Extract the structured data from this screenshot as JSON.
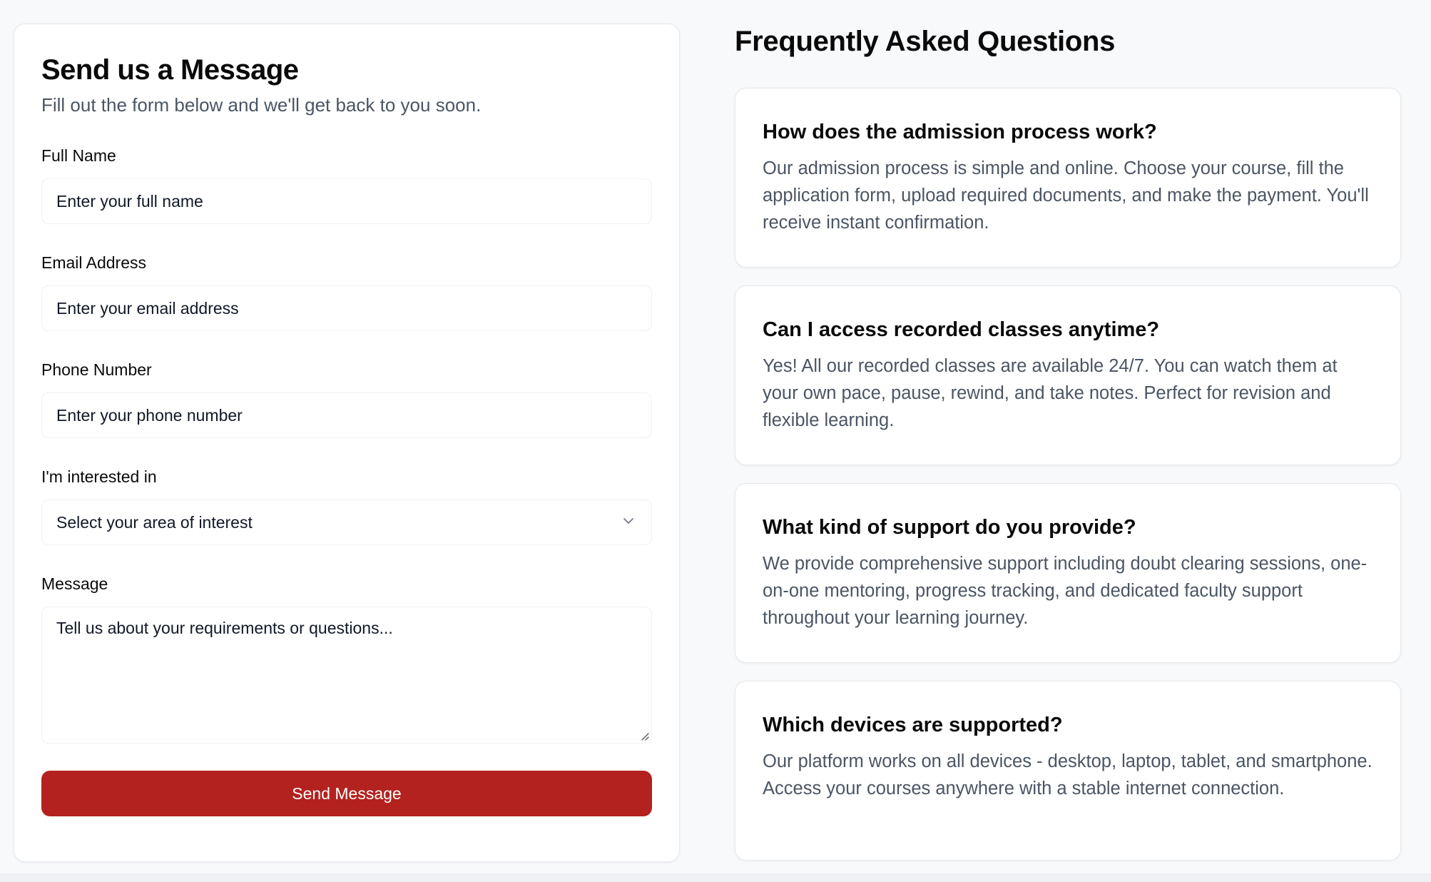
{
  "form": {
    "title": "Send us a Message",
    "subtitle": "Fill out the form below and we'll get back to you soon.",
    "fields": {
      "full_name": {
        "label": "Full Name",
        "placeholder": "Enter your full name",
        "value": ""
      },
      "email": {
        "label": "Email Address",
        "placeholder": "Enter your email address",
        "value": ""
      },
      "phone": {
        "label": "Phone Number",
        "placeholder": "Enter your phone number",
        "value": ""
      },
      "interest": {
        "label": "I'm interested in",
        "selected": "Select your area of interest"
      },
      "message": {
        "label": "Message",
        "placeholder": "Tell us about your requirements or questions...",
        "value": ""
      }
    },
    "submit_label": "Send Message"
  },
  "faq": {
    "title": "Frequently Asked Questions",
    "items": [
      {
        "question": "How does the admission process work?",
        "answer": "Our admission process is simple and online. Choose your course, fill the application form, upload required documents, and make the payment. You'll receive instant confirmation."
      },
      {
        "question": "Can I access recorded classes anytime?",
        "answer": "Yes! All our recorded classes are available 24/7. You can watch them at your own pace, pause, rewind, and take notes. Perfect for revision and flexible learning."
      },
      {
        "question": "What kind of support do you provide?",
        "answer": "We provide comprehensive support including doubt clearing sessions, one-on-one mentoring, progress tracking, and dedicated faculty support throughout your learning journey."
      },
      {
        "question": "Which devices are supported?",
        "answer": "Our platform works on all devices - desktop, laptop, tablet, and smartphone. Access your courses anywhere with a stable internet connection."
      }
    ]
  },
  "colors": {
    "accent": "#b3221f",
    "background": "#f8f9fb",
    "card": "#ffffff",
    "muted_text": "#4b5563"
  },
  "icons": {
    "select_chevron": "chevron-down-icon",
    "textarea_resize": "resize-handle-icon"
  }
}
